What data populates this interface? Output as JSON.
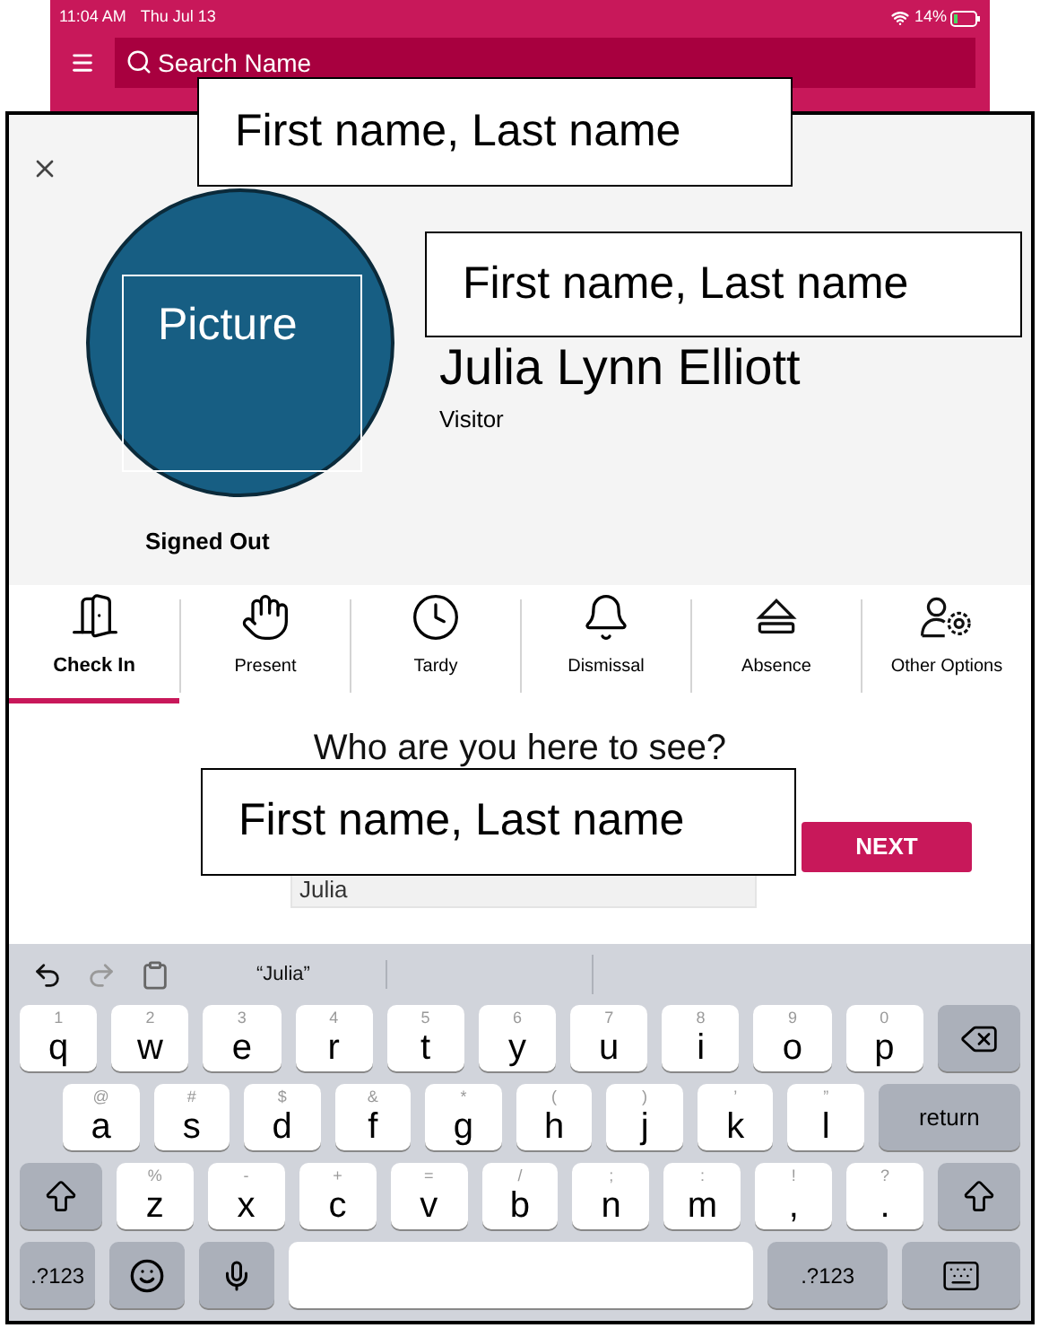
{
  "status_bar": {
    "time": "11:04 AM",
    "date": "Thu Jul 13",
    "battery": "14%"
  },
  "search": {
    "placeholder": "Search Name"
  },
  "profile": {
    "name": "Julia Lynn Elliott",
    "role": "Visitor",
    "status": "Signed Out"
  },
  "tabs": [
    {
      "label": "Check In",
      "selected": true
    },
    {
      "label": "Present",
      "selected": false
    },
    {
      "label": "Tardy",
      "selected": false
    },
    {
      "label": "Dismissal",
      "selected": false
    },
    {
      "label": "Absence",
      "selected": false
    },
    {
      "label": "Other Options",
      "selected": false
    }
  ],
  "question": "Who are you here to see?",
  "visit_field": {
    "value": "Julia"
  },
  "next_button": "NEXT",
  "overlays": [
    {
      "kind": "label",
      "text": "First name, Last name"
    },
    {
      "kind": "label",
      "text": "First name, Last name"
    },
    {
      "kind": "label",
      "text": "First name, Last name"
    },
    {
      "kind": "picture",
      "text": "Picture"
    }
  ],
  "keyboard": {
    "suggestions": [
      "“Julia”"
    ],
    "rows": [
      [
        {
          "kind": "letter",
          "label": "q",
          "hint": "1"
        },
        {
          "kind": "letter",
          "label": "w",
          "hint": "2"
        },
        {
          "kind": "letter",
          "label": "e",
          "hint": "3"
        },
        {
          "kind": "letter",
          "label": "r",
          "hint": "4"
        },
        {
          "kind": "letter",
          "label": "t",
          "hint": "5"
        },
        {
          "kind": "letter",
          "label": "y",
          "hint": "6"
        },
        {
          "kind": "letter",
          "label": "u",
          "hint": "7"
        },
        {
          "kind": "letter",
          "label": "i",
          "hint": "8"
        },
        {
          "kind": "letter",
          "label": "o",
          "hint": "9"
        },
        {
          "kind": "letter",
          "label": "p",
          "hint": "0"
        },
        {
          "kind": "backspace"
        }
      ],
      [
        {
          "kind": "letter",
          "label": "a",
          "hint": "@"
        },
        {
          "kind": "letter",
          "label": "s",
          "hint": "#"
        },
        {
          "kind": "letter",
          "label": "d",
          "hint": "$"
        },
        {
          "kind": "letter",
          "label": "f",
          "hint": "&"
        },
        {
          "kind": "letter",
          "label": "g",
          "hint": "*"
        },
        {
          "kind": "letter",
          "label": "h",
          "hint": "("
        },
        {
          "kind": "letter",
          "label": "j",
          "hint": ")"
        },
        {
          "kind": "letter",
          "label": "k",
          "hint": "’"
        },
        {
          "kind": "letter",
          "label": "l",
          "hint": "”"
        },
        {
          "kind": "return",
          "label": "return"
        }
      ],
      [
        {
          "kind": "shift"
        },
        {
          "kind": "letter",
          "label": "z",
          "hint": "%"
        },
        {
          "kind": "letter",
          "label": "x",
          "hint": "-"
        },
        {
          "kind": "letter",
          "label": "c",
          "hint": "+"
        },
        {
          "kind": "letter",
          "label": "v",
          "hint": "="
        },
        {
          "kind": "letter",
          "label": "b",
          "hint": "/"
        },
        {
          "kind": "letter",
          "label": "n",
          "hint": ";"
        },
        {
          "kind": "letter",
          "label": "m",
          "hint": ":"
        },
        {
          "kind": "letter",
          "label": ",",
          "hint": "!"
        },
        {
          "kind": "letter",
          "label": ".",
          "hint": "?"
        },
        {
          "kind": "shift"
        }
      ],
      [
        {
          "kind": "mode",
          "label": ".?123"
        },
        {
          "kind": "emoji"
        },
        {
          "kind": "mic"
        },
        {
          "kind": "space"
        },
        {
          "kind": "mode",
          "label": ".?123"
        },
        {
          "kind": "hide"
        }
      ]
    ]
  }
}
